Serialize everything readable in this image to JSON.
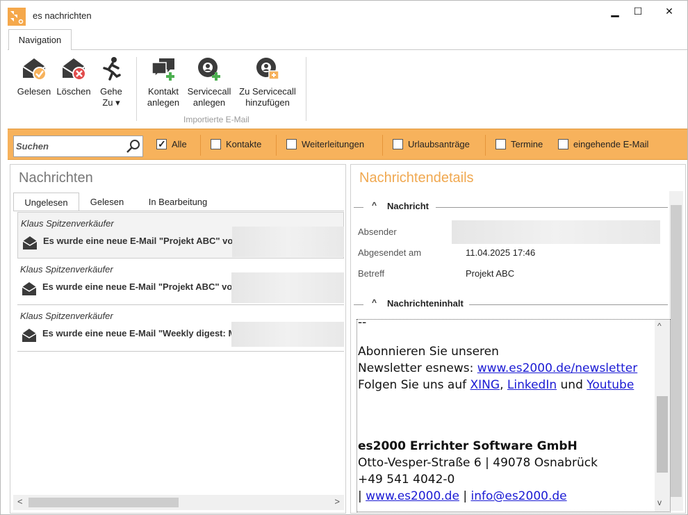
{
  "window": {
    "title": "es nachrichten",
    "minimize": "▁",
    "maximize": "☐",
    "close": "✕"
  },
  "ribbon": {
    "tab": "Navigation",
    "buttons": {
      "gelesen": "Gelesen",
      "loeschen": "Löschen",
      "gehe_line1": "Gehe",
      "gehe_line2": "Zu ▾",
      "kontakt_line1": "Kontakt",
      "kontakt_line2": "anlegen",
      "servicecall_line1": "Servicecall",
      "servicecall_line2": "anlegen",
      "zu_servicecall_line1": "Zu Servicecall",
      "zu_servicecall_line2": "hinzufügen"
    },
    "group_label": "Importierte E-Mail"
  },
  "filter": {
    "search_placeholder": "Suchen",
    "items": [
      {
        "label": "Alle",
        "checked": true
      },
      {
        "label": "Kontakte",
        "checked": false
      },
      {
        "label": "Weiterleitungen",
        "checked": false
      },
      {
        "label": "Urlaubsanträge",
        "checked": false
      },
      {
        "label": "Termine",
        "checked": false
      },
      {
        "label": "eingehende E-Mail",
        "checked": false
      }
    ]
  },
  "messages_panel": {
    "title": "Nachrichten",
    "tabs": [
      "Ungelesen",
      "Gelesen",
      "In Bearbeitung"
    ],
    "messages": [
      {
        "sender": "Klaus Spitzenverkäufer",
        "subject": "Es wurde eine neue E-Mail \"Projekt ABC\" vo"
      },
      {
        "sender": "Klaus Spitzenverkäufer",
        "subject": "Es wurde eine neue E-Mail \"Projekt ABC\" vo"
      },
      {
        "sender": "Klaus Spitzenverkäufer",
        "subject": "Es wurde eine neue E-Mail \"Weekly digest: M"
      }
    ]
  },
  "details_panel": {
    "title": "Nachrichtendetails",
    "section_message": "Nachricht",
    "field_sender_label": "Absender",
    "field_sent_label": "Abgesendet am",
    "field_sent_value": "11.04.2025 17:46",
    "field_subject_label": "Betreff",
    "field_subject_value": "Projekt ABC",
    "section_content": "Nachrichteninhalt",
    "content": {
      "dashes": "--",
      "line1": "Abonnieren Sie unseren",
      "line2_prefix": "Newsletter esnews: ",
      "line2_link": "www.es2000.de/newsletter",
      "line3_prefix": "Folgen Sie uns auf ",
      "link_xing": "XING",
      "comma": ", ",
      "link_linkedin": "LinkedIn",
      "und": " und ",
      "link_youtube": "Youtube",
      "company": "es2000 Errichter Software GmbH",
      "address": "Otto-Vesper-Straße 6 | 49078 Osnabrück",
      "phone": "+49 541 4042-0",
      "pipe1": "| ",
      "link_web": "www.es2000.de",
      "pipe2": " | ",
      "link_mail": "info@es2000.de"
    }
  },
  "colors": {
    "accent": "#f7b25c",
    "title_orange": "#f0a850",
    "link": "#1a1ad4"
  }
}
